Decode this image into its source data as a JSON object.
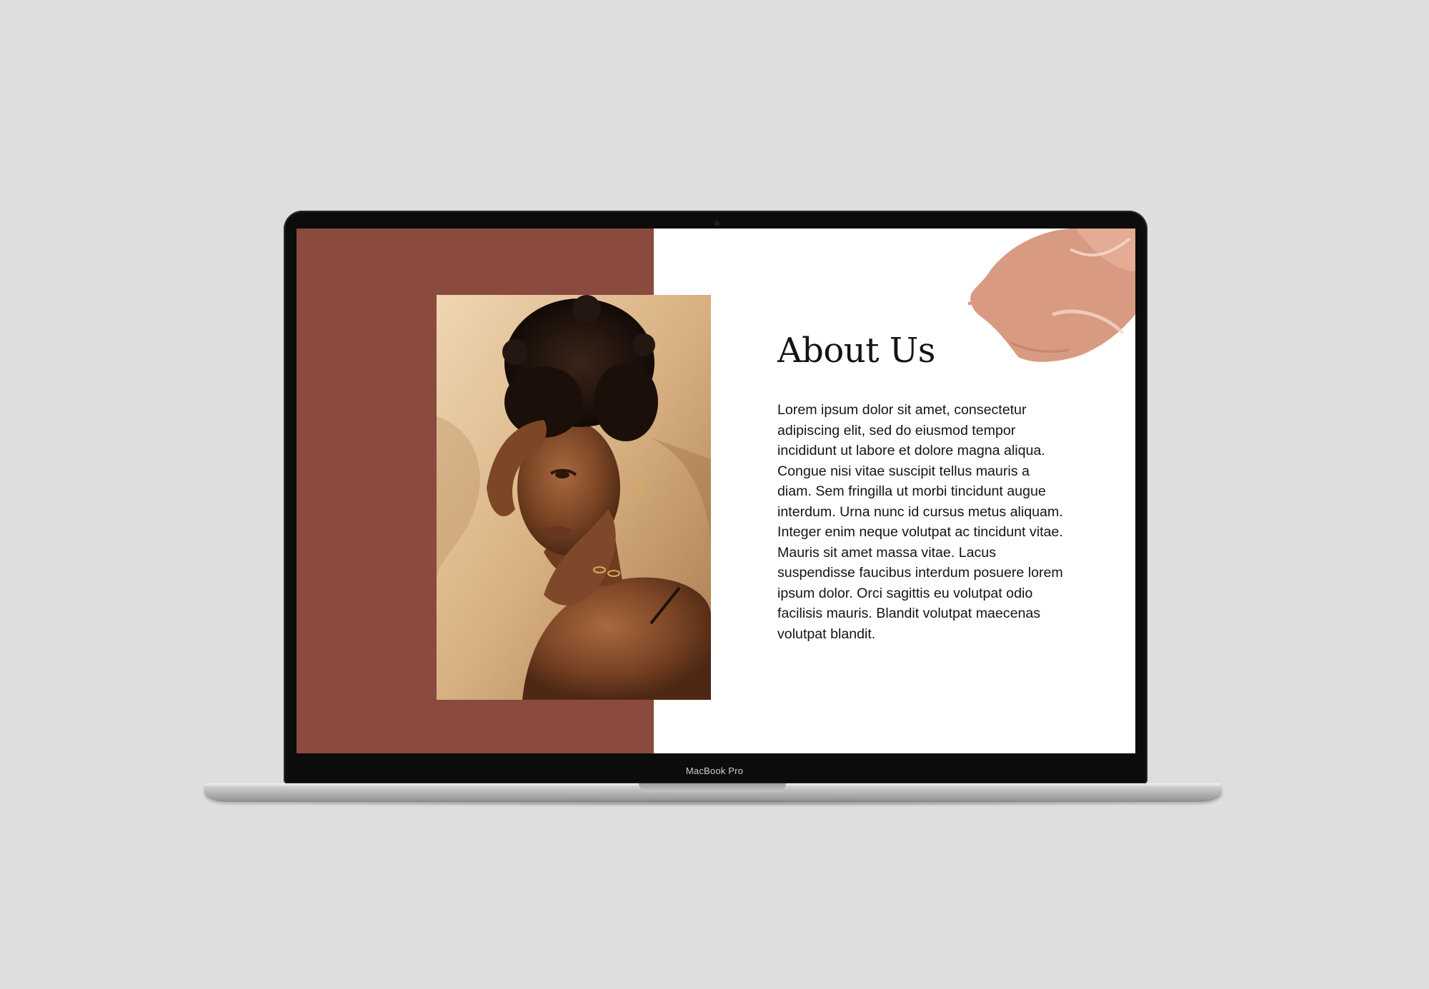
{
  "device": {
    "brand_label": "MacBook Pro"
  },
  "page": {
    "heading": "About Us",
    "body": "Lorem ipsum dolor sit amet, consectetur adipiscing elit, sed do eiusmod tempor incididunt ut labore et dolore magna aliqua. Congue nisi vitae suscipit tellus mauris a diam. Sem fringilla ut morbi tincidunt augue interdum. Urna nunc id cursus metus aliquam. Integer enim neque volutpat ac tincidunt vitae. Mauris sit amet massa vitae. Lacus suspendisse faucibus interdum posuere lorem ipsum dolor. Orci sagittis eu volutpat odio facilisis mauris. Blandit volutpat maecenas volutpat blandit."
  },
  "colors": {
    "background": "#dedede",
    "accent_panel": "#8b4a3e",
    "paint_swatch": "#d99a82",
    "text": "#141414"
  }
}
